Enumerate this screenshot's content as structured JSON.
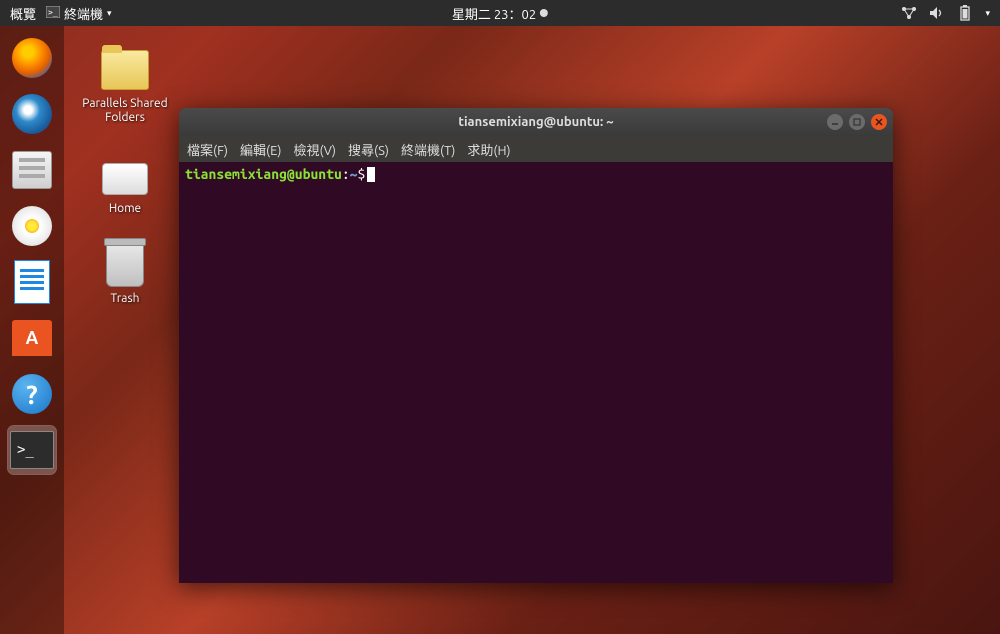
{
  "topbar": {
    "activities": "概覽",
    "app_name": "終端機",
    "clock": "星期二 23：02"
  },
  "dock": {
    "items": [
      {
        "name": "firefox"
      },
      {
        "name": "thunderbird"
      },
      {
        "name": "files"
      },
      {
        "name": "rhythmbox"
      },
      {
        "name": "writer"
      },
      {
        "name": "software"
      },
      {
        "name": "help"
      },
      {
        "name": "terminal",
        "active": true
      }
    ]
  },
  "desktop_icons": [
    {
      "name": "parallels-shared",
      "label": "Parallels Shared Folders"
    },
    {
      "name": "home",
      "label": "Home"
    },
    {
      "name": "trash",
      "label": "Trash"
    }
  ],
  "terminal": {
    "title": "tiansemixiang@ubuntu: ~",
    "menu": [
      "檔案(F)",
      "編輯(E)",
      "檢視(V)",
      "搜尋(S)",
      "終端機(T)",
      "求助(H)"
    ],
    "prompt": {
      "user_host": "tiansemixiang@ubuntu",
      "colon": ":",
      "path": "~",
      "symbol": "$"
    }
  }
}
